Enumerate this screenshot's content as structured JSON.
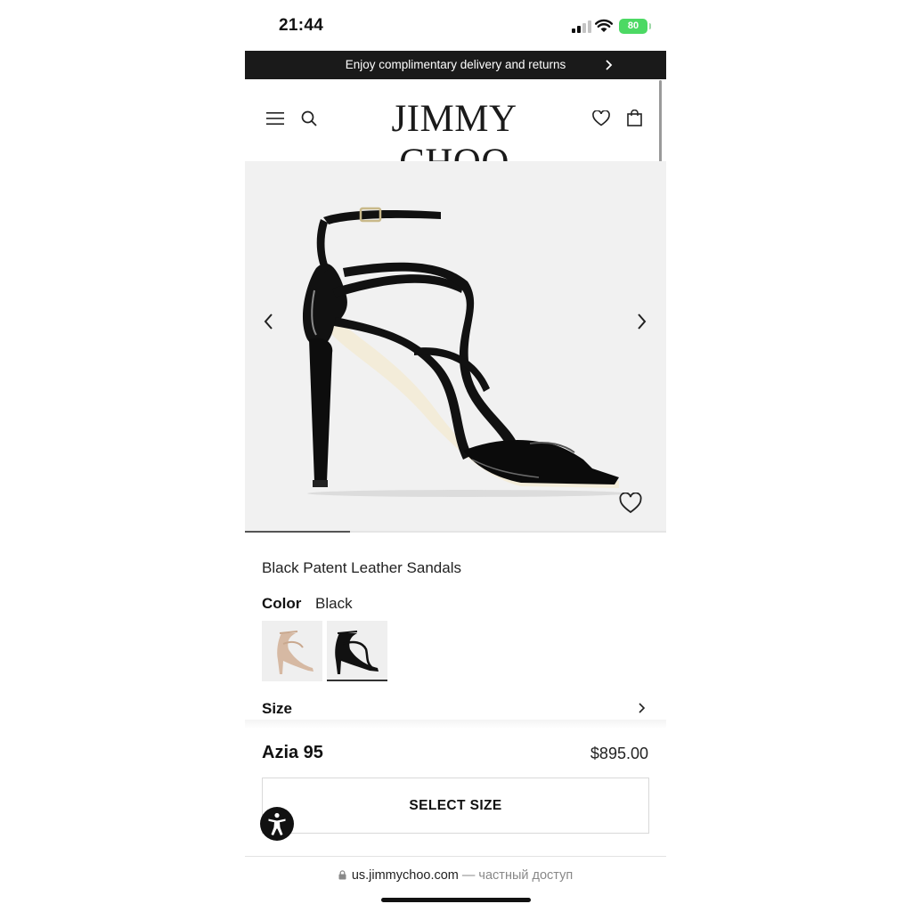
{
  "status_bar": {
    "time": "21:44",
    "battery": "80"
  },
  "promo": {
    "text": "Enjoy complimentary delivery and returns"
  },
  "header": {
    "logo": "JIMMY CHOO"
  },
  "product": {
    "name": "Black Patent Leather Sandals",
    "color_label": "Color",
    "color_value": "Black",
    "swatches": [
      "nude",
      "black"
    ],
    "size_label": "Size",
    "model": "Azia 95",
    "price": "$895.00",
    "cta": "SELECT SIZE"
  },
  "gallery": {
    "current_slide": 1,
    "total_slides": 4
  },
  "browser": {
    "domain": "us.jimmychoo.com",
    "suffix": "— частный доступ"
  },
  "icons": {
    "menu": "hamburger-icon",
    "search": "search-icon",
    "wishlist": "heart-icon",
    "bag": "shopping-bag-icon",
    "accessibility": "accessibility-icon",
    "lock": "lock-icon"
  },
  "colors": {
    "banner_bg": "#1a1a1a",
    "hero_bg": "#f1f1f1",
    "battery": "#4cd964"
  }
}
